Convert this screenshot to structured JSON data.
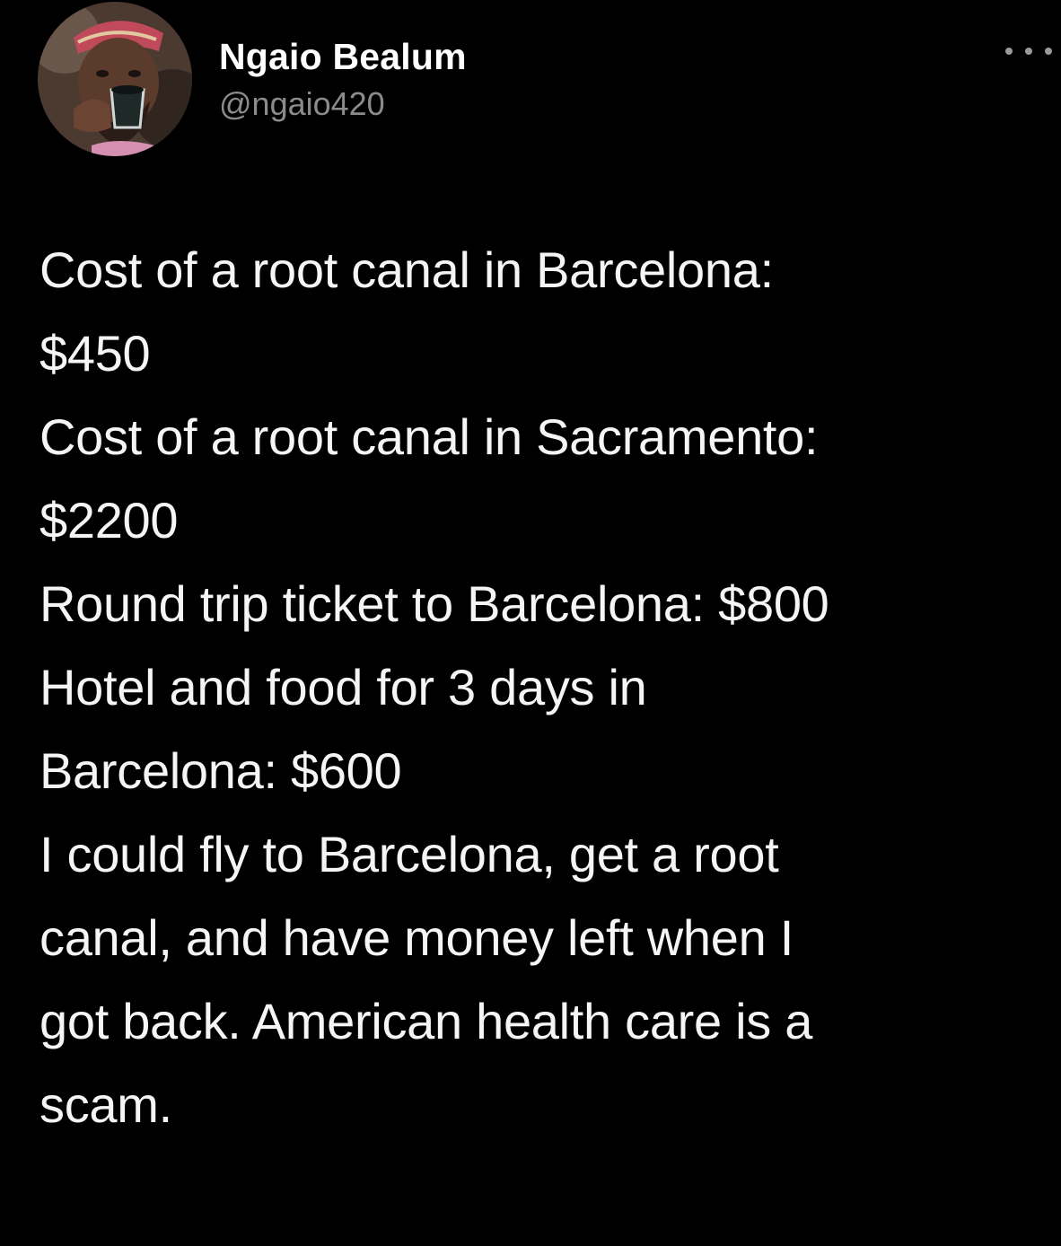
{
  "author": {
    "display_name": "Ngaio Bealum",
    "handle": "@ngaio420",
    "avatar_icon": "profile-photo"
  },
  "actions": {
    "more_icon": "more-options-icon"
  },
  "tweet": {
    "lines": [
      "Cost of a root canal in Barcelona:",
      "$450",
      "Cost of a root canal in Sacramento:",
      "$2200",
      "Round trip ticket to Barcelona: $800",
      "Hotel and food for 3 days in",
      "Barcelona: $600",
      "I could fly to Barcelona, get a root",
      "canal, and have money left when I",
      "got back. American health care is a",
      "scam."
    ]
  },
  "colors": {
    "background": "#000000",
    "text": "#ffffff",
    "secondary_text": "#8b8b8b"
  }
}
